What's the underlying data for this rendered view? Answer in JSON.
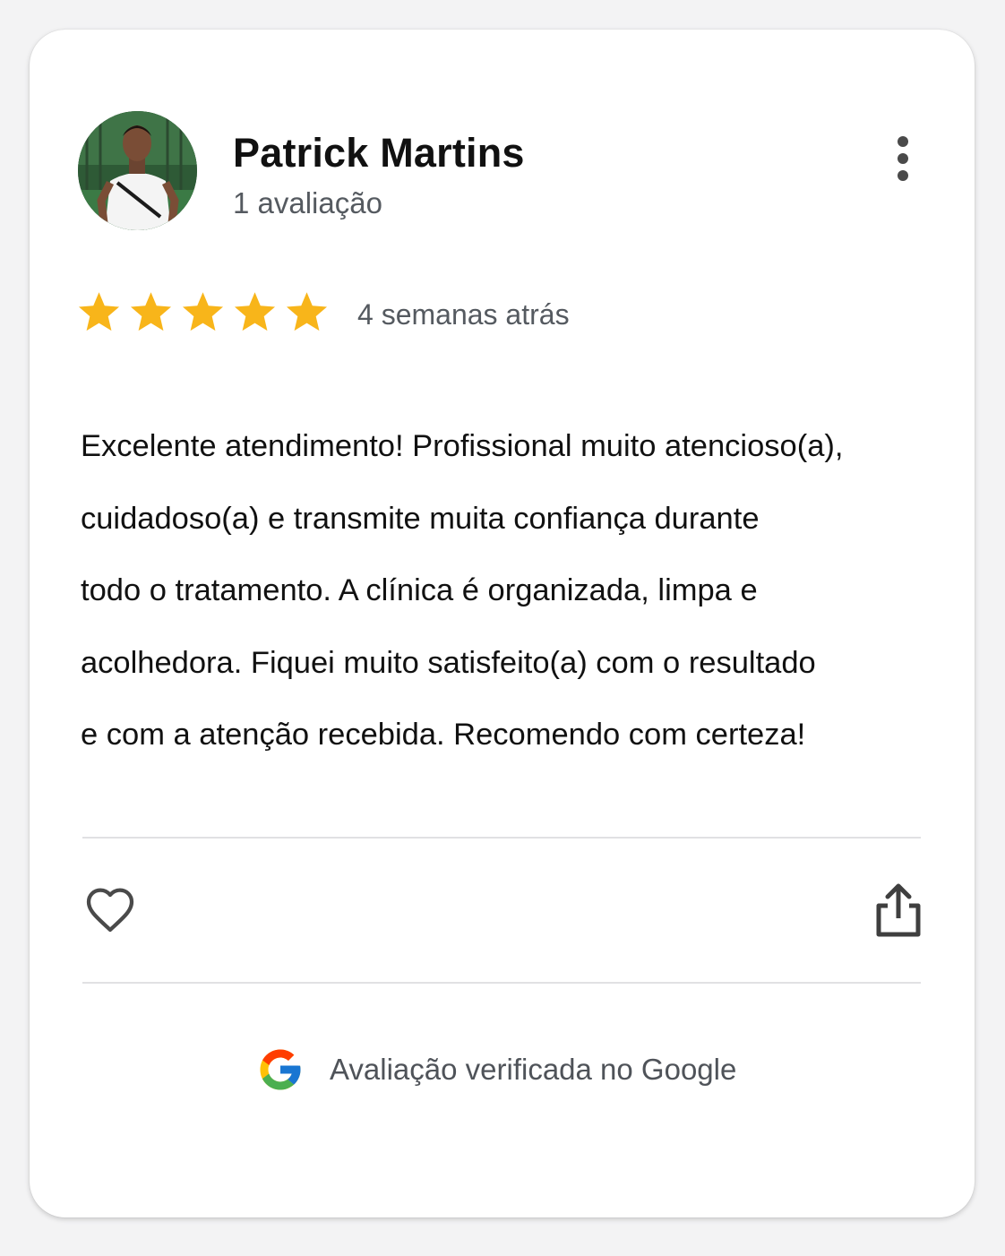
{
  "review": {
    "reviewer_name": "Patrick Martins",
    "review_count": "1 avaliação",
    "rating": 5,
    "rating_max": 5,
    "time_ago": "4 semanas atrás",
    "text_lines": [
      "Excelente atendimento! Profissional muito atencioso(a),",
      "cuidadoso(a) e transmite muita confiança durante",
      "todo o tratamento. A clínica é organizada, limpa e",
      "acolhedora. Fiquei muito satisfeito(a) com o resultado",
      "e com a atenção recebida. Recomendo com certeza!"
    ]
  },
  "actions": {
    "more_icon": "more-vert-icon",
    "like_icon": "heart-outline-icon",
    "share_icon": "share-icon"
  },
  "footer": {
    "verified_label": "Avaliação verificada no Google",
    "brand_icon": "google-g-icon"
  },
  "colors": {
    "star": "#F8B51A",
    "name": "#111111",
    "muted": "#555A60",
    "icon": "#4A4A4A",
    "divider": "#E1E1E3",
    "card_bg": "#FFFFFF",
    "page_bg": "#F3F3F4"
  }
}
